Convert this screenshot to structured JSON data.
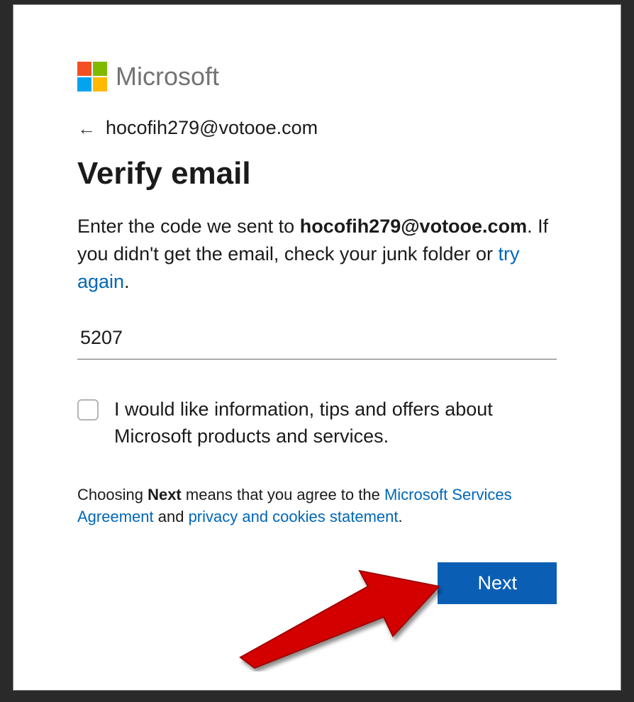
{
  "brand": {
    "name": "Microsoft"
  },
  "back": {
    "email": "hocofih279@votooe.com"
  },
  "heading": "Verify email",
  "instruction": {
    "prefix": "Enter the code we sent to ",
    "email": "hocofih279@votooe.com",
    "middle": ". If you didn't get the email, check your junk folder or ",
    "try_again": "try again",
    "suffix": "."
  },
  "code_input": {
    "value": "5207"
  },
  "optin": {
    "label": "I would like information, tips and offers about Microsoft products and services."
  },
  "agreement": {
    "prefix": "Choosing ",
    "next_word": "Next",
    "middle1": " means that you agree to the ",
    "link1": "Microsoft Services Agreement",
    "middle2": " and ",
    "link2": "privacy and cookies statement",
    "suffix": "."
  },
  "buttons": {
    "next": "Next"
  },
  "colors": {
    "link": "#0067b8",
    "primary_button": "#0a5fb4",
    "logo_red": "#f25022",
    "logo_green": "#7fba00",
    "logo_blue": "#00a4ef",
    "logo_yellow": "#ffb900"
  }
}
